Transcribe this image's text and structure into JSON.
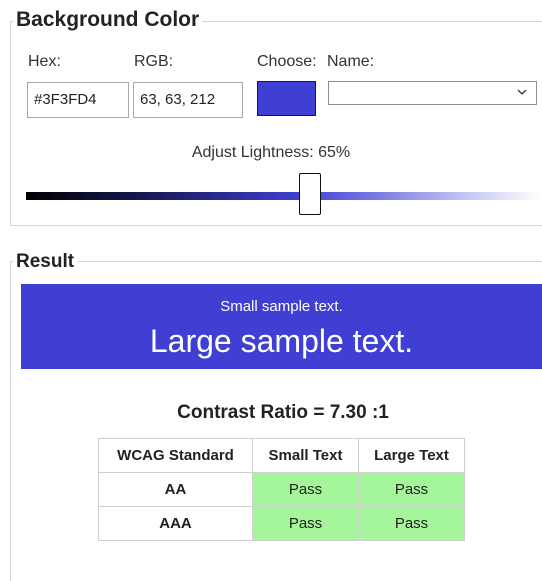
{
  "background_section": {
    "title": "Background Color",
    "hex_label": "Hex:",
    "hex_value": "#3F3FD4",
    "rgb_label": "RGB:",
    "rgb_value": "63, 63, 212",
    "choose_label": "Choose:",
    "name_label": "Name:",
    "name_value": "",
    "chosen_color": "#3F3FD4",
    "lightness_label": "Adjust Lightness: 65%",
    "lightness_percent": 65
  },
  "result_section": {
    "title": "Result",
    "sample_bg": "#3F3FD4",
    "sample_fg": "#FFFFFF",
    "small_sample": "Small sample text.",
    "large_sample": "Large sample text.",
    "contrast_ratio": "Contrast Ratio = 7.30 :1",
    "table": {
      "headers": [
        "WCAG Standard",
        "Small Text",
        "Large Text"
      ],
      "rows": [
        {
          "standard": "AA",
          "small": "Pass",
          "large": "Pass"
        },
        {
          "standard": "AAA",
          "small": "Pass",
          "large": "Pass"
        }
      ]
    },
    "pass_color": "#A5F59A"
  },
  "icons": {
    "select_arrow": "chevron-down-icon"
  }
}
